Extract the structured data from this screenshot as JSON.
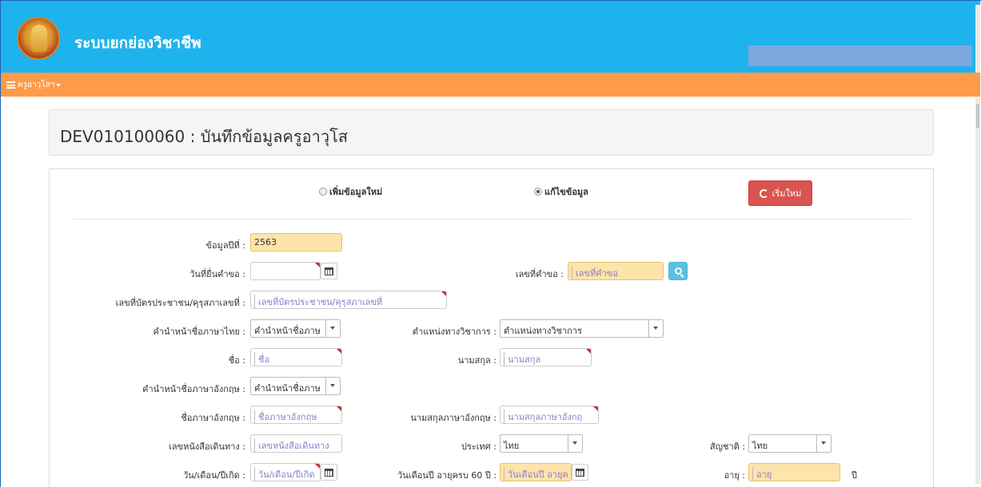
{
  "app": {
    "title": "ระบบยกย่องวิชาชีพ"
  },
  "nav": {
    "menu_label": "ครูอาวุโสฯ"
  },
  "page": {
    "title": "DEV010100060 : บันทึกข้อมูลครูอาวุโส"
  },
  "mode": {
    "option_new": "เพิ่มข้อมูลใหม่",
    "option_edit": "แก้ไขข้อมูล",
    "selected": "edit",
    "reset_label": "เริ่มใหม่"
  },
  "form": {
    "year": {
      "label": "ข้อมูลปีที่ :",
      "value": "2563"
    },
    "request_date": {
      "label": "วันที่ยื่นคำขอ :",
      "value": ""
    },
    "request_no": {
      "label": "เลขที่คำขอ :",
      "placeholder": "เลขที่คำขอ"
    },
    "id_card": {
      "label": "เลขที่บัตรประชาชน/คุรุสภาเลขที่ :",
      "placeholder": "เลขที่บัตรประชาชน/คุรุสภาเลขที่"
    },
    "prefix_th": {
      "label": "คำนำหน้าชื่อภาษาไทย :",
      "value": "คำนำหน้าชื่อภาษ"
    },
    "academic_pos": {
      "label": "ตำแหน่งทางวิชาการ :",
      "value": "ตำแหน่งทางวิชาการ"
    },
    "first_name": {
      "label": "ชื่อ :",
      "placeholder": "ชื่อ"
    },
    "last_name": {
      "label": "นามสกุล :",
      "placeholder": "นามสกุล"
    },
    "prefix_en": {
      "label": "คำนำหน้าชื่อภาษาอังกฤษ :",
      "value": "คำนำหน้าชื่อภาษ"
    },
    "first_name_en": {
      "label": "ชื่อภาษาอังกฤษ :",
      "placeholder": "ชื่อภาษาอังกฤษ"
    },
    "last_name_en": {
      "label": "นามสกุลภาษาอังกฤษ :",
      "placeholder": "นามสกุลภาษาอังกฤ"
    },
    "passport": {
      "label": "เลขหนังสือเดินทาง :",
      "placeholder": "เลขหนังสือเดินทาง"
    },
    "country": {
      "label": "ประเทศ :",
      "value": "ไทย"
    },
    "nationality": {
      "label": "สัญชาติ :",
      "value": "ไทย"
    },
    "birth_date": {
      "label": "วัน/เดือน/ปีเกิด :",
      "placeholder": "วัน/เดือน/ปีเกิด"
    },
    "age60_date": {
      "label": "วันเดือนปี อายุครบ 60 ปี :",
      "placeholder": "วันเดือนปี อายุค"
    },
    "age": {
      "label": "อายุ :",
      "placeholder": "อายุ",
      "unit": "ปี"
    }
  },
  "colors": {
    "header": "#1fb3ed",
    "navbar": "#fe9a49",
    "danger": "#d9534f",
    "info": "#5bc0de",
    "readonly": "#fde4ab"
  }
}
